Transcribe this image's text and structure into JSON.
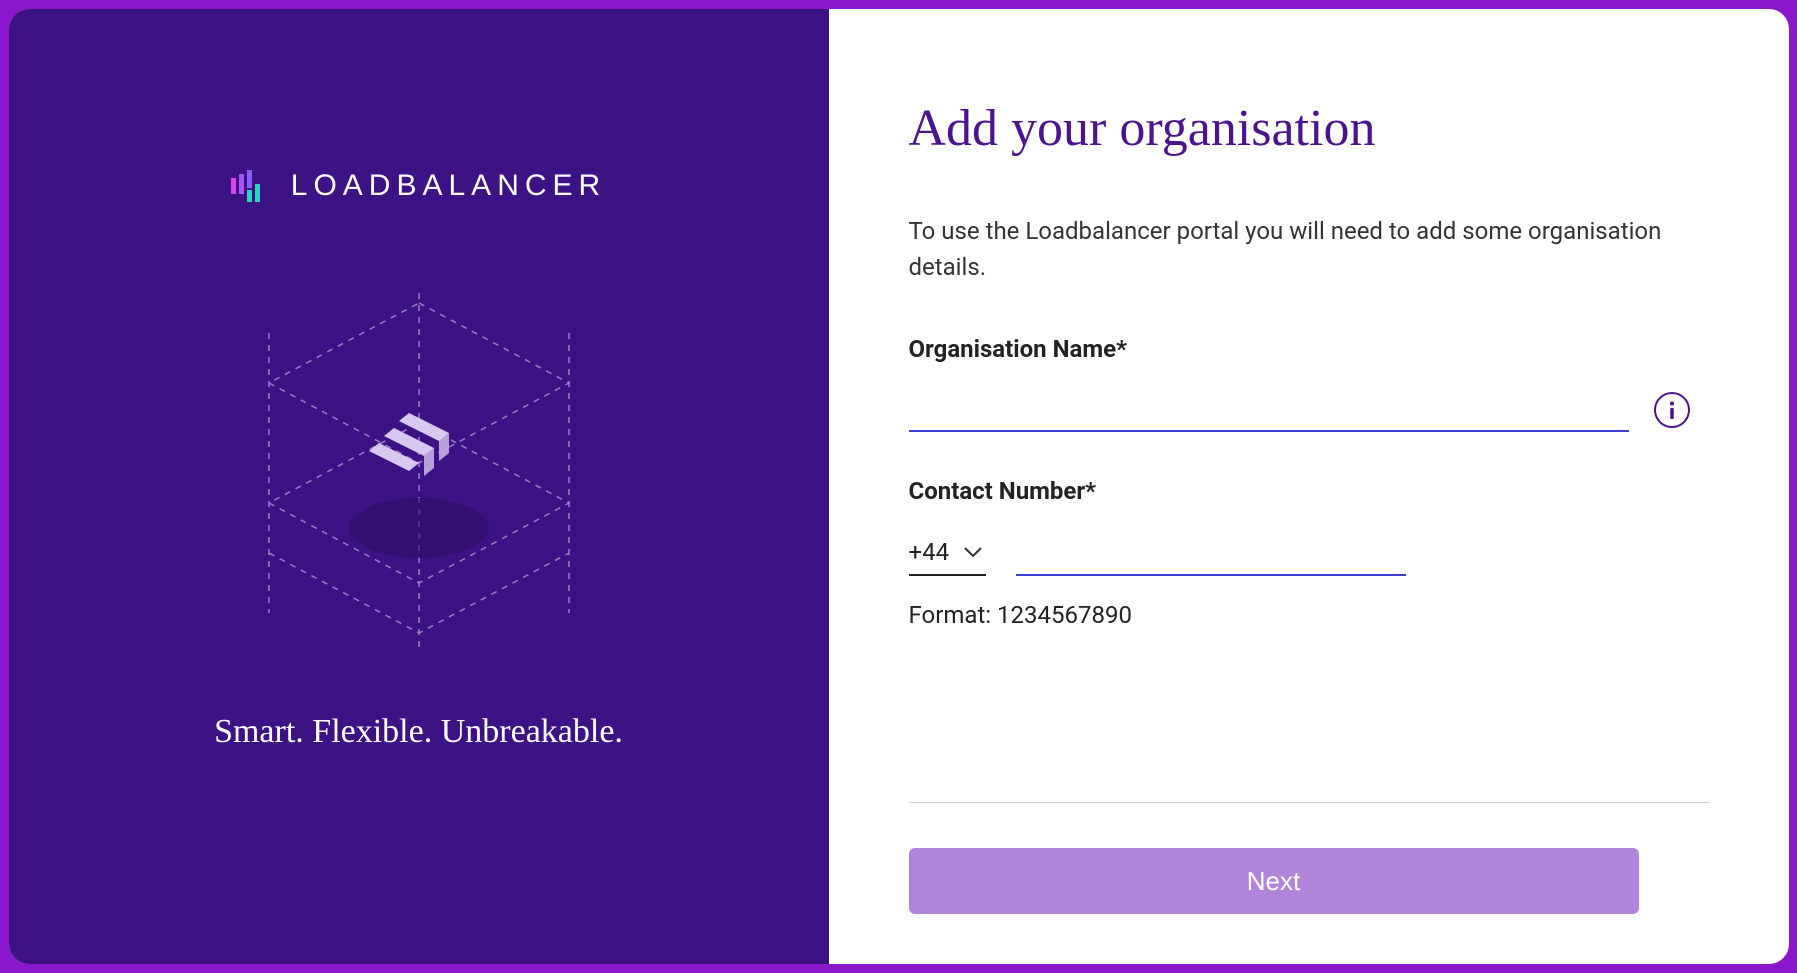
{
  "brand": {
    "name": "LOADBALANCER",
    "tagline": "Smart. Flexible. Unbreakable."
  },
  "page": {
    "title": "Add your organisation",
    "description": "To use the Loadbalancer portal you will need to add some organisation details."
  },
  "form": {
    "org_name": {
      "label": "Organisation Name*",
      "value": ""
    },
    "contact_number": {
      "label": "Contact Number*",
      "country_code": "+44",
      "value": "",
      "format_hint": "Format: 1234567890"
    }
  },
  "actions": {
    "next_label": "Next"
  }
}
